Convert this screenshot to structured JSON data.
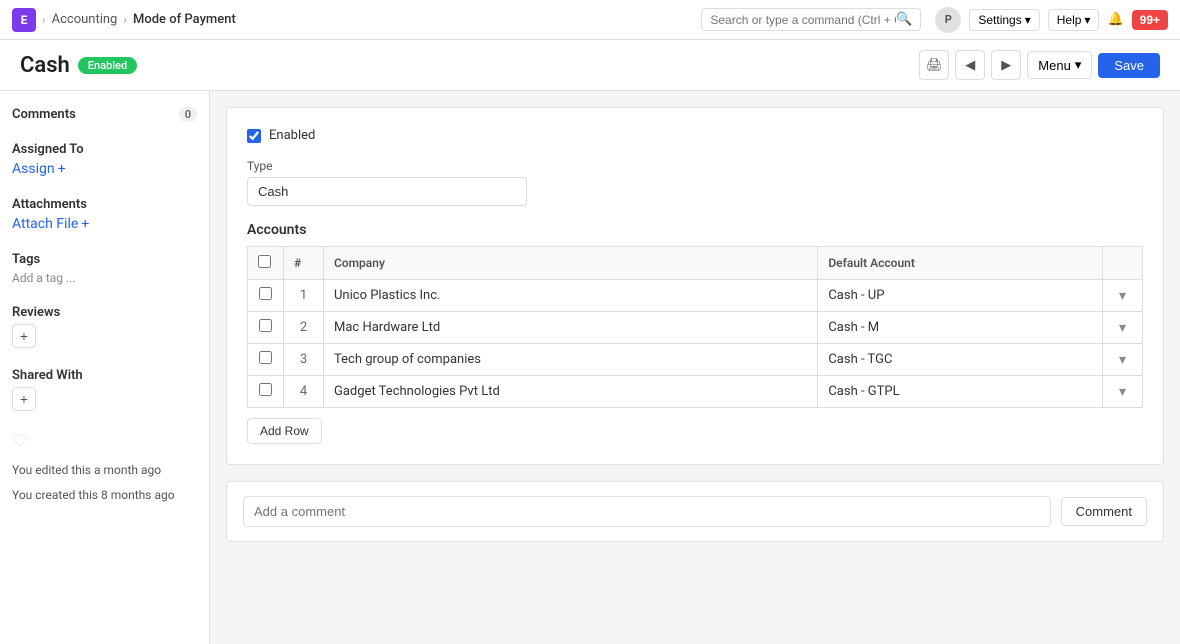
{
  "navbar": {
    "logo": "E",
    "breadcrumb1": "Accounting",
    "chevron": "›",
    "breadcrumb2": "Mode of Payment",
    "search_placeholder": "Search or type a command (Ctrl + G)",
    "avatar_label": "P",
    "settings_label": "Settings",
    "help_label": "Help",
    "plus_label": "99+"
  },
  "page": {
    "title": "Cash",
    "status": "Enabled",
    "menu_label": "Menu",
    "save_label": "Save"
  },
  "sidebar": {
    "comments_label": "Comments",
    "comments_count": "0",
    "assigned_to_label": "Assigned To",
    "assign_label": "Assign",
    "attachments_label": "Attachments",
    "attach_file_label": "Attach File",
    "tags_label": "Tags",
    "add_tag_label": "Add a tag ...",
    "reviews_label": "Reviews",
    "shared_with_label": "Shared With",
    "activity1": "You edited this a month ago",
    "activity2": "You created this 8 months ago"
  },
  "form": {
    "enabled_label": "Enabled",
    "type_label": "Type",
    "type_value": "Cash",
    "accounts_label": "Accounts",
    "col_company": "Company",
    "col_default_account": "Default Account",
    "rows": [
      {
        "num": 1,
        "company": "Unico Plastics Inc.",
        "account": "Cash - UP"
      },
      {
        "num": 2,
        "company": "Mac Hardware Ltd",
        "account": "Cash - M"
      },
      {
        "num": 3,
        "company": "Tech group of companies",
        "account": "Cash - TGC"
      },
      {
        "num": 4,
        "company": "Gadget Technologies Pvt Ltd",
        "account": "Cash - GTPL"
      }
    ],
    "add_row_label": "Add Row"
  },
  "comment": {
    "placeholder": "Add a comment",
    "button_label": "Comment"
  }
}
